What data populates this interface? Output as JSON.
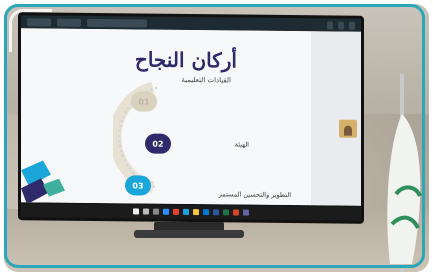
{
  "slide": {
    "title": "أركان النجاح",
    "subtitle": "القيادات التعليمية",
    "items": [
      {
        "number": "01",
        "label": ""
      },
      {
        "number": "02",
        "label": "الهيئة"
      },
      {
        "number": "03",
        "label": "التطوير والتحسين المستمر"
      }
    ]
  },
  "colors": {
    "frame": "#2aa7b8",
    "title": "#2f2a6a",
    "badge_primary": "#2f2a6a",
    "badge_accent": "#1aa6d8",
    "badge_muted": "#d9d2bf"
  },
  "taskbar_icons": [
    "start-icon",
    "search-icon",
    "task-view-icon",
    "zoom-icon",
    "chrome-icon",
    "edge-icon",
    "folder-icon",
    "mail-icon",
    "word-icon",
    "excel-icon",
    "powerpoint-icon",
    "teams-icon"
  ]
}
